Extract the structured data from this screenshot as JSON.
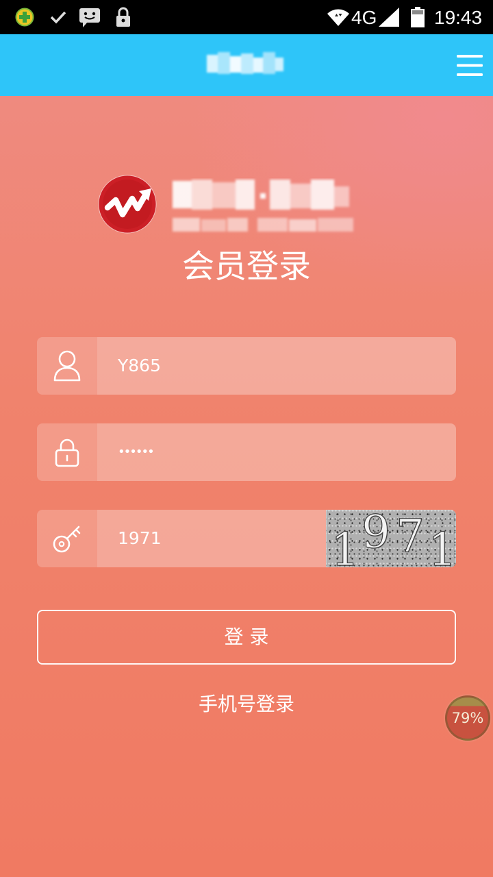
{
  "status_bar": {
    "network_type": "4G",
    "time": "19:43",
    "icons": {
      "app": "app-notification-icon",
      "check": "check-icon",
      "message": "message-icon",
      "lock": "lock-icon",
      "wifi": "wifi-icon",
      "signal": "signal-icon",
      "battery": "battery-icon"
    }
  },
  "header": {
    "menu_icon": "hamburger-menu-icon"
  },
  "brand": {
    "logo_icon": "brand-logo-icon"
  },
  "login_form": {
    "title": "会员登录",
    "username": {
      "icon": "user-icon",
      "value": "Y865"
    },
    "password": {
      "icon": "lock-icon",
      "value": "••••••"
    },
    "captcha": {
      "icon": "key-icon",
      "value": "1971",
      "image_digits": [
        "1",
        "9",
        "7",
        "1"
      ]
    },
    "submit_label": "登 录",
    "alt_login_label": "手机号登录"
  },
  "float_widget": {
    "label": "79%",
    "fill_level": 0.79
  },
  "colors": {
    "header_bg": "#2EC5F9",
    "page_bg_top": "#EF8A7F",
    "page_bg_bottom": "#F07A62",
    "logo_red": "#CC1F26",
    "captcha_bg": "#B0B0B0"
  }
}
